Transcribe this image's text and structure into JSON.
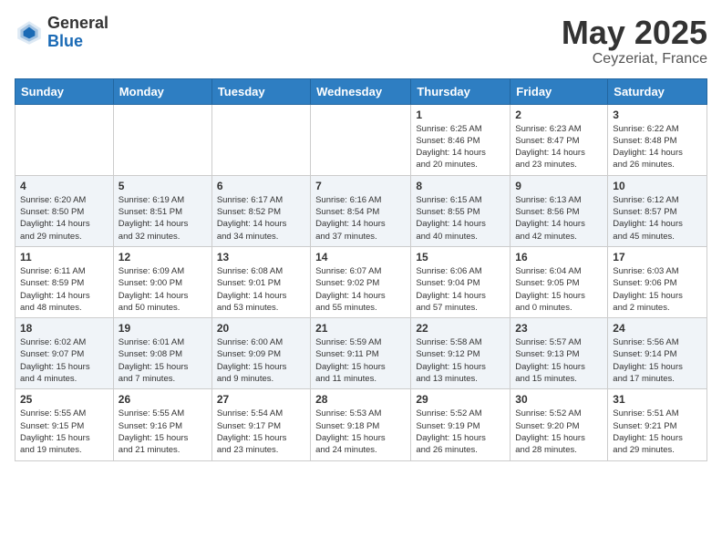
{
  "header": {
    "logo_general": "General",
    "logo_blue": "Blue",
    "month": "May 2025",
    "location": "Ceyzeriat, France"
  },
  "weekdays": [
    "Sunday",
    "Monday",
    "Tuesday",
    "Wednesday",
    "Thursday",
    "Friday",
    "Saturday"
  ],
  "weeks": [
    [
      {
        "day": "",
        "info": ""
      },
      {
        "day": "",
        "info": ""
      },
      {
        "day": "",
        "info": ""
      },
      {
        "day": "",
        "info": ""
      },
      {
        "day": "1",
        "info": "Sunrise: 6:25 AM\nSunset: 8:46 PM\nDaylight: 14 hours\nand 20 minutes."
      },
      {
        "day": "2",
        "info": "Sunrise: 6:23 AM\nSunset: 8:47 PM\nDaylight: 14 hours\nand 23 minutes."
      },
      {
        "day": "3",
        "info": "Sunrise: 6:22 AM\nSunset: 8:48 PM\nDaylight: 14 hours\nand 26 minutes."
      }
    ],
    [
      {
        "day": "4",
        "info": "Sunrise: 6:20 AM\nSunset: 8:50 PM\nDaylight: 14 hours\nand 29 minutes."
      },
      {
        "day": "5",
        "info": "Sunrise: 6:19 AM\nSunset: 8:51 PM\nDaylight: 14 hours\nand 32 minutes."
      },
      {
        "day": "6",
        "info": "Sunrise: 6:17 AM\nSunset: 8:52 PM\nDaylight: 14 hours\nand 34 minutes."
      },
      {
        "day": "7",
        "info": "Sunrise: 6:16 AM\nSunset: 8:54 PM\nDaylight: 14 hours\nand 37 minutes."
      },
      {
        "day": "8",
        "info": "Sunrise: 6:15 AM\nSunset: 8:55 PM\nDaylight: 14 hours\nand 40 minutes."
      },
      {
        "day": "9",
        "info": "Sunrise: 6:13 AM\nSunset: 8:56 PM\nDaylight: 14 hours\nand 42 minutes."
      },
      {
        "day": "10",
        "info": "Sunrise: 6:12 AM\nSunset: 8:57 PM\nDaylight: 14 hours\nand 45 minutes."
      }
    ],
    [
      {
        "day": "11",
        "info": "Sunrise: 6:11 AM\nSunset: 8:59 PM\nDaylight: 14 hours\nand 48 minutes."
      },
      {
        "day": "12",
        "info": "Sunrise: 6:09 AM\nSunset: 9:00 PM\nDaylight: 14 hours\nand 50 minutes."
      },
      {
        "day": "13",
        "info": "Sunrise: 6:08 AM\nSunset: 9:01 PM\nDaylight: 14 hours\nand 53 minutes."
      },
      {
        "day": "14",
        "info": "Sunrise: 6:07 AM\nSunset: 9:02 PM\nDaylight: 14 hours\nand 55 minutes."
      },
      {
        "day": "15",
        "info": "Sunrise: 6:06 AM\nSunset: 9:04 PM\nDaylight: 14 hours\nand 57 minutes."
      },
      {
        "day": "16",
        "info": "Sunrise: 6:04 AM\nSunset: 9:05 PM\nDaylight: 15 hours\nand 0 minutes."
      },
      {
        "day": "17",
        "info": "Sunrise: 6:03 AM\nSunset: 9:06 PM\nDaylight: 15 hours\nand 2 minutes."
      }
    ],
    [
      {
        "day": "18",
        "info": "Sunrise: 6:02 AM\nSunset: 9:07 PM\nDaylight: 15 hours\nand 4 minutes."
      },
      {
        "day": "19",
        "info": "Sunrise: 6:01 AM\nSunset: 9:08 PM\nDaylight: 15 hours\nand 7 minutes."
      },
      {
        "day": "20",
        "info": "Sunrise: 6:00 AM\nSunset: 9:09 PM\nDaylight: 15 hours\nand 9 minutes."
      },
      {
        "day": "21",
        "info": "Sunrise: 5:59 AM\nSunset: 9:11 PM\nDaylight: 15 hours\nand 11 minutes."
      },
      {
        "day": "22",
        "info": "Sunrise: 5:58 AM\nSunset: 9:12 PM\nDaylight: 15 hours\nand 13 minutes."
      },
      {
        "day": "23",
        "info": "Sunrise: 5:57 AM\nSunset: 9:13 PM\nDaylight: 15 hours\nand 15 minutes."
      },
      {
        "day": "24",
        "info": "Sunrise: 5:56 AM\nSunset: 9:14 PM\nDaylight: 15 hours\nand 17 minutes."
      }
    ],
    [
      {
        "day": "25",
        "info": "Sunrise: 5:55 AM\nSunset: 9:15 PM\nDaylight: 15 hours\nand 19 minutes."
      },
      {
        "day": "26",
        "info": "Sunrise: 5:55 AM\nSunset: 9:16 PM\nDaylight: 15 hours\nand 21 minutes."
      },
      {
        "day": "27",
        "info": "Sunrise: 5:54 AM\nSunset: 9:17 PM\nDaylight: 15 hours\nand 23 minutes."
      },
      {
        "day": "28",
        "info": "Sunrise: 5:53 AM\nSunset: 9:18 PM\nDaylight: 15 hours\nand 24 minutes."
      },
      {
        "day": "29",
        "info": "Sunrise: 5:52 AM\nSunset: 9:19 PM\nDaylight: 15 hours\nand 26 minutes."
      },
      {
        "day": "30",
        "info": "Sunrise: 5:52 AM\nSunset: 9:20 PM\nDaylight: 15 hours\nand 28 minutes."
      },
      {
        "day": "31",
        "info": "Sunrise: 5:51 AM\nSunset: 9:21 PM\nDaylight: 15 hours\nand 29 minutes."
      }
    ]
  ]
}
